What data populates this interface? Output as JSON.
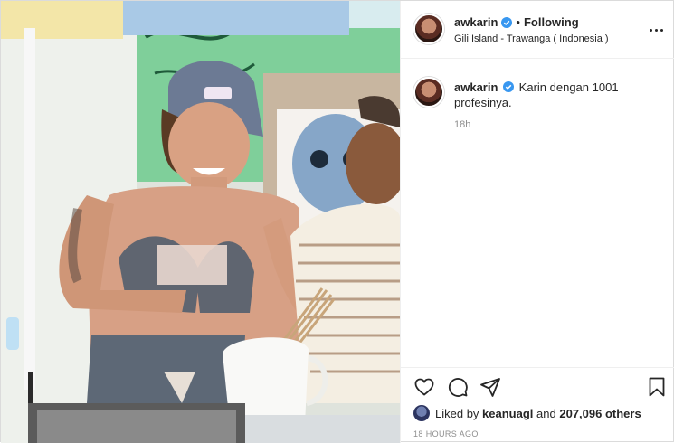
{
  "post": {
    "username": "awkarin",
    "verified": true,
    "separator": "•",
    "follow_state": "Following",
    "location": "Gili Island - Trawanga ( Indonesia )",
    "more_icon": "more-horizontal-icon"
  },
  "caption": {
    "username": "awkarin",
    "text": "Karin dengan 1001 profesinya.",
    "time": "18h"
  },
  "actions": {
    "like_icon": "heart-icon",
    "comment_icon": "comment-icon",
    "share_icon": "share-icon",
    "save_icon": "bookmark-icon"
  },
  "likes": {
    "prefix": "Liked by",
    "user": "keanuagl",
    "joiner": "and",
    "others": "207,096 others"
  },
  "post_date": "18 HOURS AGO",
  "colors": {
    "text": "#262626",
    "muted": "#8e8e8e",
    "verified_blue": "#3897f0",
    "border": "#efefef"
  }
}
